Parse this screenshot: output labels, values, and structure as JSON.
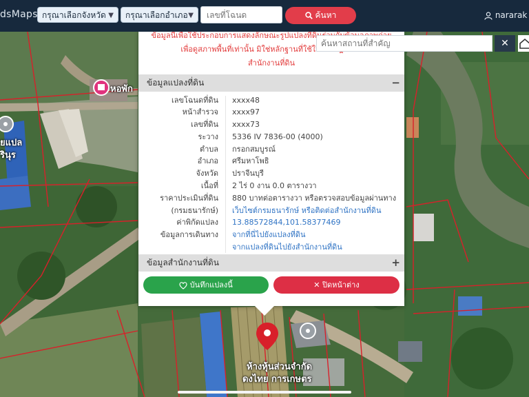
{
  "topbar": {
    "brand": "dsMaps",
    "province_select": "กรุณาเลือกจังหวัด",
    "district_select": "กรุณาเลือกอำเภอ",
    "deed_placeholder": "เลขที่โฉนด",
    "search_label": "ค้นหา",
    "user_name": "nararak"
  },
  "map": {
    "place_search_placeholder": "ค้นหาสถานที่สำคัญ",
    "labels": {
      "top_label": "หอพัก",
      "left_label_1": "ยแปล",
      "left_label_2": "รินุร",
      "bottom_label_1": "ห้างหุ้นส่วนจำกัด",
      "bottom_label_2": "ดงไทย การเกษตร"
    }
  },
  "popup": {
    "warning_lines": [
      "ข้อมูลนี้เพื่อใช้ประกอบการแสดงลักษณะรูปแปลงที่ดินร่วมกับข้อมูลภาพถ่าย",
      "เพื่อดูสภาพพื้นที่เท่านั้น มิใช่หลักฐานที่ใช้ในทางกฎหมาย",
      "สำนักงานที่ดิน"
    ],
    "land_section_title": "ข้อมูลแปลงที่ดิน",
    "land_section_toggle": "−",
    "rows": [
      {
        "label": "เลขโฉนดที่ดิน",
        "value": "xxxx48"
      },
      {
        "label": "หน้าสำรวจ",
        "value": "xxxx97"
      },
      {
        "label": "เลขที่ดิน",
        "value": "xxxx73"
      },
      {
        "label": "ระวาง",
        "value": "5336 IV 7836-00 (4000)"
      },
      {
        "label": "ตำบล",
        "value": "กรอกสมบูรณ์"
      },
      {
        "label": "อำเภอ",
        "value": "ศรีมหาโพธิ"
      },
      {
        "label": "จังหวัด",
        "value": "ปราจีนบุรี"
      },
      {
        "label": "เนื้อที่",
        "value": "2 ไร่ 0 งาน 0.0 ตารางวา"
      },
      {
        "label": "ราคาประเมินที่ดิน",
        "value": "880 บาทต่อตารางวา หรือตรวจสอบข้อมูลผ่านทาง"
      },
      {
        "label": "(กรมธนารักษ์)",
        "value": "เว็บไซต์กรมธนารักษ์ หรือติดต่อสำนักงานที่ดิน",
        "link": true
      },
      {
        "label": "ค่าพิกัดแปลง",
        "value": "13.88572844,101.58377469",
        "link": true
      },
      {
        "label": "ข้อมูลการเดินทาง",
        "value": "จากที่นี่ไปยังแปลงที่ดิน",
        "link": true
      },
      {
        "label": "",
        "value": "จากแปลงที่ดินไปยังสำนักงานที่ดิน",
        "link": true
      }
    ],
    "office_section_title": "ข้อมูลสำนักงานที่ดิน",
    "office_section_toggle": "+",
    "save_label": "บันทึกแปลงนี้",
    "close_label": "ปิดหน้าต่าง"
  },
  "colors": {
    "topbar": "#17293d",
    "accent_red": "#e23d4a",
    "save_green": "#2aa34b",
    "link_blue": "#2f73c4",
    "warning_red": "#e23b3b",
    "parcel_line": "#d8202a"
  }
}
